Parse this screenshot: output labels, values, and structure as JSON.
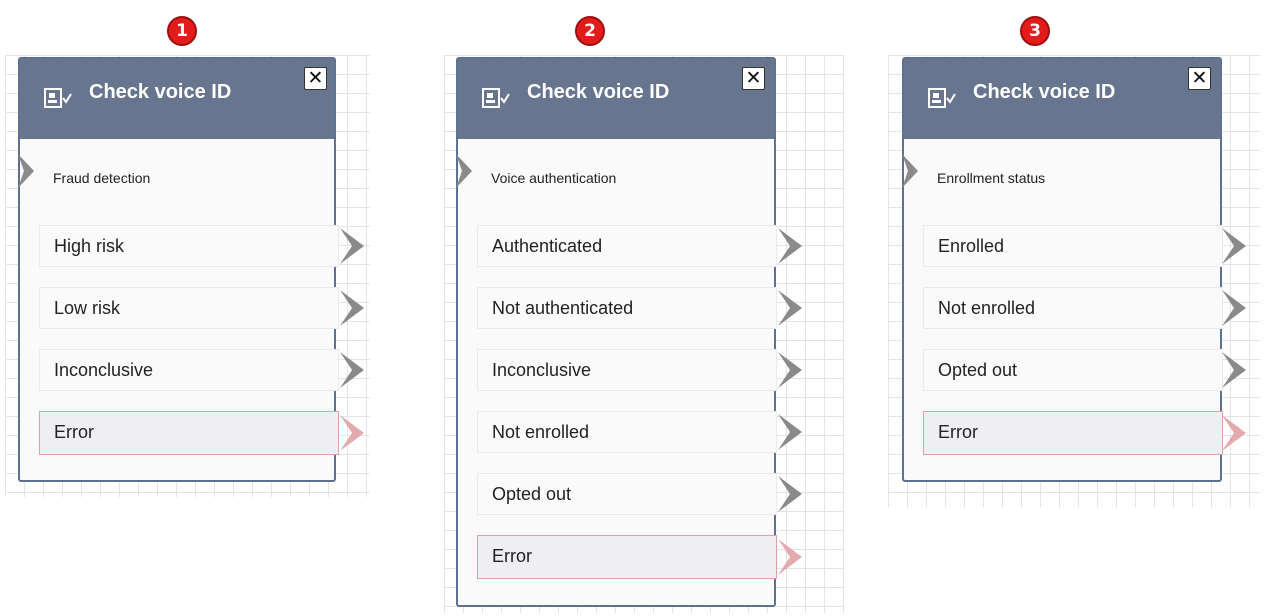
{
  "blocks": [
    {
      "badge": "1",
      "title": "Check voice ID",
      "close": "✕",
      "label": "Fraud detection",
      "branches": [
        "High risk",
        "Low risk",
        "Inconclusive",
        "Error"
      ]
    },
    {
      "badge": "2",
      "title": "Check voice ID",
      "close": "✕",
      "label": "Voice authentication",
      "branches": [
        "Authenticated",
        "Not authenticated",
        "Inconclusive",
        "Not enrolled",
        "Opted out",
        "Error"
      ]
    },
    {
      "badge": "3",
      "title": "Check voice ID",
      "close": "✕",
      "label": "Enrollment status",
      "branches": [
        "Enrolled",
        "Not enrolled",
        "Opted out",
        "Error"
      ]
    }
  ],
  "colors": {
    "header": "#67758f",
    "border": "#5f7190",
    "badge": "#e21b1b",
    "connector": "#8a8a8a",
    "error_connector": "#e3a9ae"
  },
  "icons": {
    "header": "contact-card-icon",
    "close": "close-icon",
    "input": "input-connector-icon",
    "output": "output-connector-icon"
  }
}
